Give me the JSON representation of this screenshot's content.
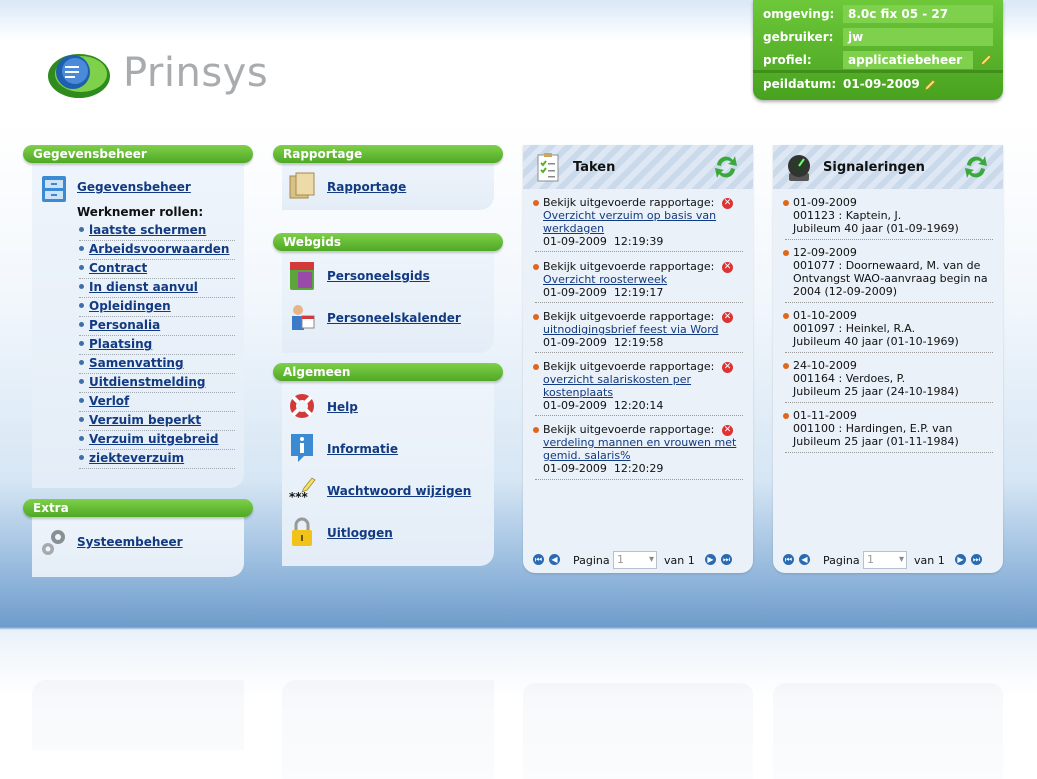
{
  "logo": {
    "text": "Prinsys"
  },
  "env": {
    "omgeving_label": "omgeving:",
    "omgeving_value": "8.0c fix 05 - 27",
    "gebruiker_label": "gebruiker:",
    "gebruiker_value": "jw",
    "profiel_label": "profiel:",
    "profiel_value": "applicatiebeheer",
    "peildatum_label": "peildatum:",
    "peildatum_value": "01-09-2009"
  },
  "gegevensbeheer": {
    "header": "Gegevensbeheer",
    "link": "Gegevensbeheer",
    "roles_label": "Werknemer rollen:",
    "roles": [
      "laatste schermen",
      "Arbeidsvoorwaarden",
      "Contract",
      "In dienst aanvul",
      "Opleidingen",
      "Personalia",
      "Plaatsing",
      "Samenvatting",
      "Uitdienstmelding",
      "Verlof",
      "Verzuim beperkt",
      "Verzuim uitgebreid",
      "ziekteverzuim"
    ]
  },
  "extra": {
    "header": "Extra",
    "link": "Systeembeheer"
  },
  "rapportage": {
    "header": "Rapportage",
    "link": "Rapportage"
  },
  "webgids": {
    "header": "Webgids",
    "links": [
      "Personeelsgids",
      "Personeelskalender"
    ]
  },
  "algemeen": {
    "header": "Algemeen",
    "links": [
      "Help",
      "Informatie",
      "Wachtwoord wijzigen",
      "Uitloggen"
    ]
  },
  "taken": {
    "title": "Taken",
    "items": [
      {
        "prefix": "Bekijk uitgevoerde rapportage:",
        "link": "Overzicht verzuim op basis van werkdagen",
        "date": "01-09-2009  12:19:39"
      },
      {
        "prefix": "Bekijk uitgevoerde rapportage:",
        "link": "Overzicht roosterweek",
        "date": "01-09-2009  12:19:17"
      },
      {
        "prefix": "Bekijk uitgevoerde rapportage:",
        "link": "uitnodigingsbrief feest via Word",
        "date": "01-09-2009  12:19:58"
      },
      {
        "prefix": "Bekijk uitgevoerde rapportage:",
        "link": "overzicht salariskosten per kostenplaats",
        "date": "01-09-2009  12:20:14"
      },
      {
        "prefix": "Bekijk uitgevoerde rapportage:",
        "link": "verdeling mannen en vrouwen met gemid. salaris%",
        "date": "01-09-2009  12:20:29"
      }
    ],
    "pager": {
      "label": "Pagina",
      "page": "1",
      "of": "van 1"
    }
  },
  "signaleringen": {
    "title": "Signaleringen",
    "items": [
      {
        "date": "01-09-2009",
        "line1": "001123 : Kaptein, J.",
        "line2": "Jubileum 40 jaar (01-09-1969)"
      },
      {
        "date": "12-09-2009",
        "line1": "001077 : Doornewaard, M. van de Ontvangst WAO-aanvraag begin na 2004 (12-09-2009)",
        "line2": ""
      },
      {
        "date": "01-10-2009",
        "line1": "001097 : Heinkel, R.A.",
        "line2": "Jubileum 40 jaar (01-10-1969)"
      },
      {
        "date": "24-10-2009",
        "line1": "001164 : Verdoes, P.",
        "line2": "Jubileum 25 jaar (24-10-1984)"
      },
      {
        "date": "01-11-2009",
        "line1": "001100 : Hardingen, E.P. van",
        "line2": "Jubileum 25 jaar (01-11-1984)"
      }
    ],
    "pager": {
      "label": "Pagina",
      "page": "1",
      "of": "van 1"
    }
  },
  "colors": {
    "accent_green": "#55b02a",
    "link_blue": "#123a82",
    "bullet_orange": "#e0661a"
  }
}
